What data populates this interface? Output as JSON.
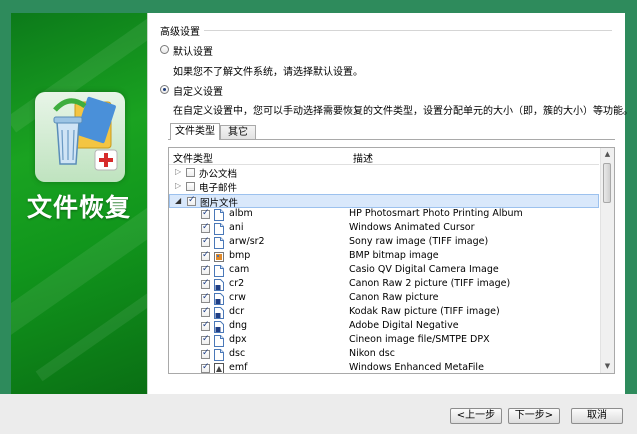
{
  "sidebar": {
    "title": "文件恢复"
  },
  "settings": {
    "group_title": "高级设置",
    "default_option": {
      "label": "默认设置",
      "description": "如果您不了解文件系统，请选择默认设置。"
    },
    "custom_option": {
      "label": "自定义设置",
      "description": "在自定义设置中，您可以手动选择需要恢复的文件类型，设置分配单元的大小（即，簇的大小）等功能。"
    }
  },
  "tabs": [
    {
      "label": "文件类型"
    },
    {
      "label": "其它"
    }
  ],
  "list": {
    "columns": {
      "type": "文件类型",
      "description": "描述"
    },
    "groups": [
      {
        "label": "办公文档",
        "checked": false
      },
      {
        "label": "电子邮件",
        "checked": false
      },
      {
        "label": "图片文件",
        "checked": true
      }
    ],
    "items": [
      {
        "name": "albm",
        "description": "HP Photosmart Photo Printing Album",
        "icon": "document-icon"
      },
      {
        "name": "ani",
        "description": "Windows Animated Cursor",
        "icon": "document-icon"
      },
      {
        "name": "arw/sr2",
        "description": "Sony raw image (TIFF image)",
        "icon": "document-icon"
      },
      {
        "name": "bmp",
        "description": "BMP bitmap image",
        "icon": "paint-icon"
      },
      {
        "name": "cam",
        "description": "Casio QV Digital Camera Image",
        "icon": "document-icon"
      },
      {
        "name": "cr2",
        "description": "Canon Raw 2 picture (TIFF image)",
        "icon": "image-file-icon"
      },
      {
        "name": "crw",
        "description": "Canon Raw picture",
        "icon": "image-file-icon"
      },
      {
        "name": "dcr",
        "description": "Kodak Raw picture (TIFF image)",
        "icon": "image-file-icon"
      },
      {
        "name": "dng",
        "description": "Adobe Digital Negative",
        "icon": "image-file-icon"
      },
      {
        "name": "dpx",
        "description": "Cineon image file/SMTPE DPX",
        "icon": "document-icon"
      },
      {
        "name": "dsc",
        "description": "Nikon dsc",
        "icon": "document-icon"
      },
      {
        "name": "emf",
        "description": "Windows Enhanced MetaFile",
        "icon": "metafile-icon"
      }
    ]
  },
  "footer": {
    "prev": "<上一步",
    "next": "下一步>",
    "cancel": "取消"
  },
  "colors": {
    "frame": "#2e8b5c",
    "sidebar": "#1aa321",
    "selection": "#d9e8fb"
  }
}
